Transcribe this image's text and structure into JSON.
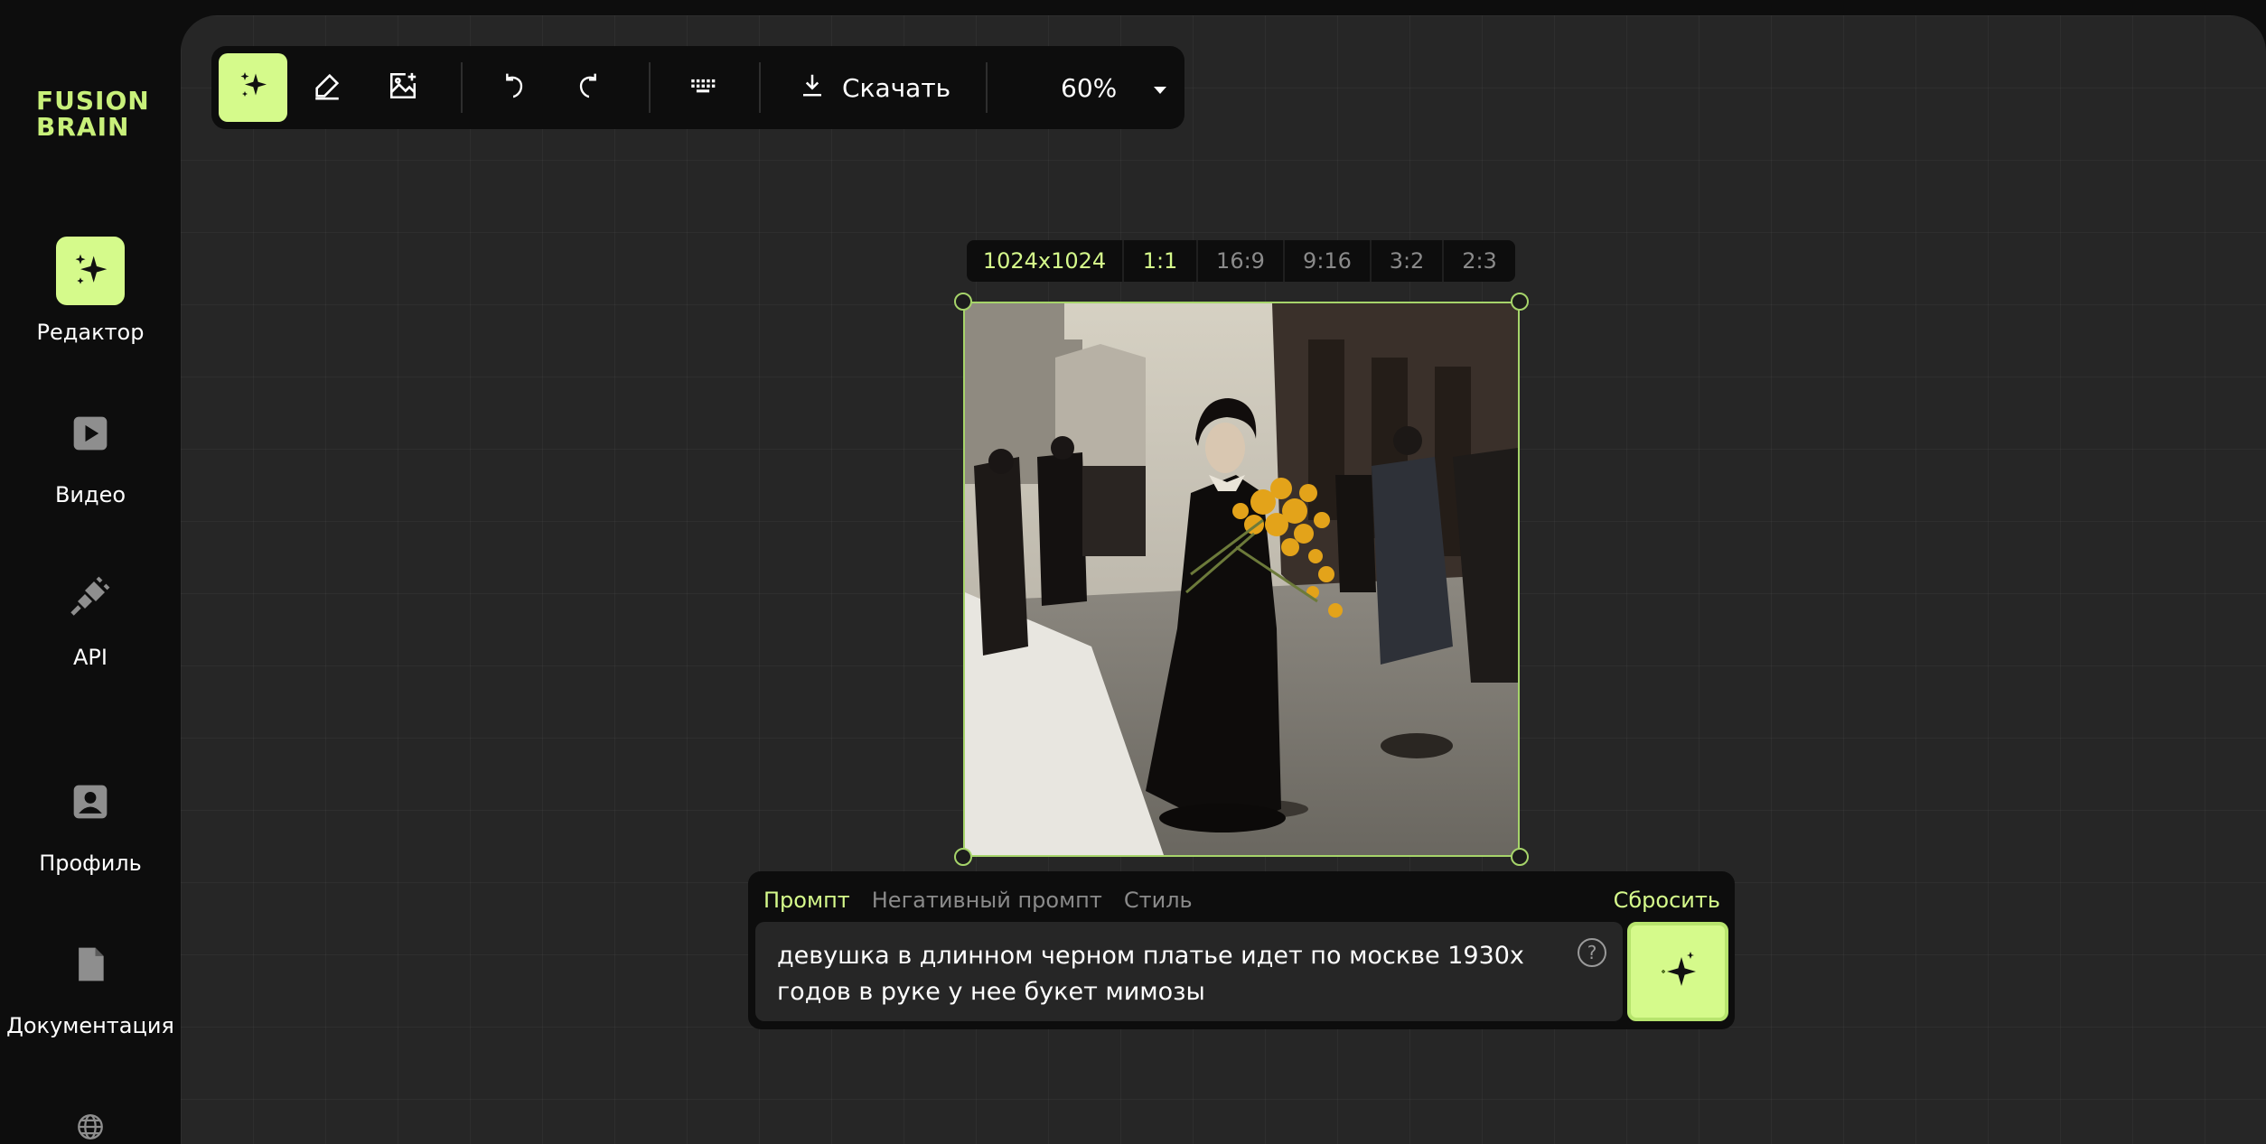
{
  "app": {
    "logo_line1": "FUSION",
    "logo_line2": "BRAIN",
    "accent_color": "#d5fa8b"
  },
  "sidebar": {
    "items": [
      {
        "label": "Редактор",
        "icon": "sparkles-icon",
        "active": true
      },
      {
        "label": "Видео",
        "icon": "play-icon",
        "active": false
      },
      {
        "label": "API",
        "icon": "plug-icon",
        "active": false
      },
      {
        "label": "Профиль",
        "icon": "profile-icon",
        "active": false
      },
      {
        "label": "Документация",
        "icon": "document-icon",
        "active": false
      },
      {
        "label": "",
        "icon": "globe-icon",
        "active": false
      }
    ]
  },
  "toolbar": {
    "tools": [
      "sparkles-icon",
      "eraser-icon",
      "image-add-icon"
    ],
    "undo_icon": "undo-icon",
    "redo_icon": "redo-icon",
    "keyboard_icon": "keyboard-icon",
    "download_label": "Скачать",
    "zoom_value": "60%"
  },
  "canvas": {
    "resolution": "1024x1024",
    "ratios": [
      "1:1",
      "16:9",
      "9:16",
      "3:2",
      "2:3"
    ],
    "selected_ratio": "1:1"
  },
  "prompt_panel": {
    "tabs": [
      "Промпт",
      "Негативный промпт",
      "Стиль"
    ],
    "active_tab": "Промпт",
    "reset_label": "Сбросить",
    "prompt_text": "девушка в длинном черном платье идет по москве 1930х годов в руке у нее букет мимозы",
    "help_symbol": "?"
  }
}
